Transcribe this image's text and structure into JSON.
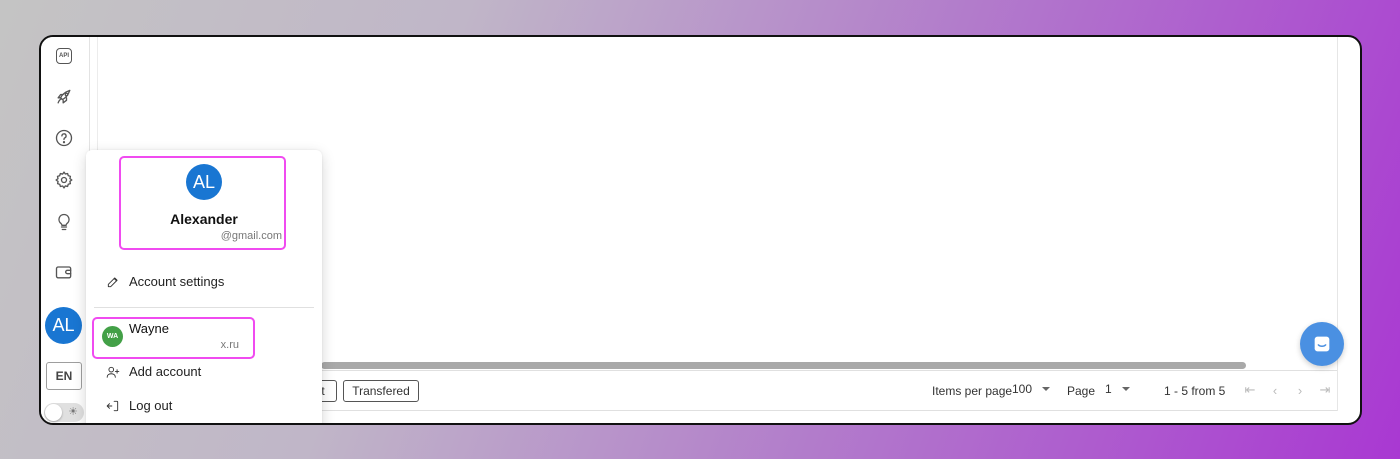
{
  "sidebar": {
    "api_label": "API",
    "avatar_initials": "AL",
    "language": "EN",
    "theme_icon": "☀"
  },
  "menu": {
    "profile": {
      "initials": "AL",
      "name": "Alexander",
      "email": "@gmail.com"
    },
    "account_settings": "Account settings",
    "other_account": {
      "initials": "WA",
      "name": "Wayne",
      "email": "x.ru"
    },
    "add_account": "Add account",
    "log_out": "Log out"
  },
  "footer": {
    "chip_partial": "t",
    "chip_transfered": "Transfered",
    "items_per_page_label": "Items per page",
    "items_per_page_value": "100",
    "page_label": "Page",
    "page_value": "1",
    "range_text": "1 - 5 from 5"
  },
  "scroll": {
    "visible_fraction": 0.925
  },
  "colors": {
    "accent_blue": "#1976d2",
    "highlight_pink": "#f04bf0",
    "account_green": "#43a047",
    "chat_blue": "#4a90e2"
  },
  "icons": [
    "api-icon",
    "rocket-icon",
    "help-icon",
    "gear-icon",
    "lightbulb-icon",
    "wallet-icon",
    "edit-icon",
    "add-user-icon",
    "logout-icon",
    "first-page-icon",
    "prev-page-icon",
    "next-page-icon",
    "last-page-icon",
    "chat-icon"
  ]
}
